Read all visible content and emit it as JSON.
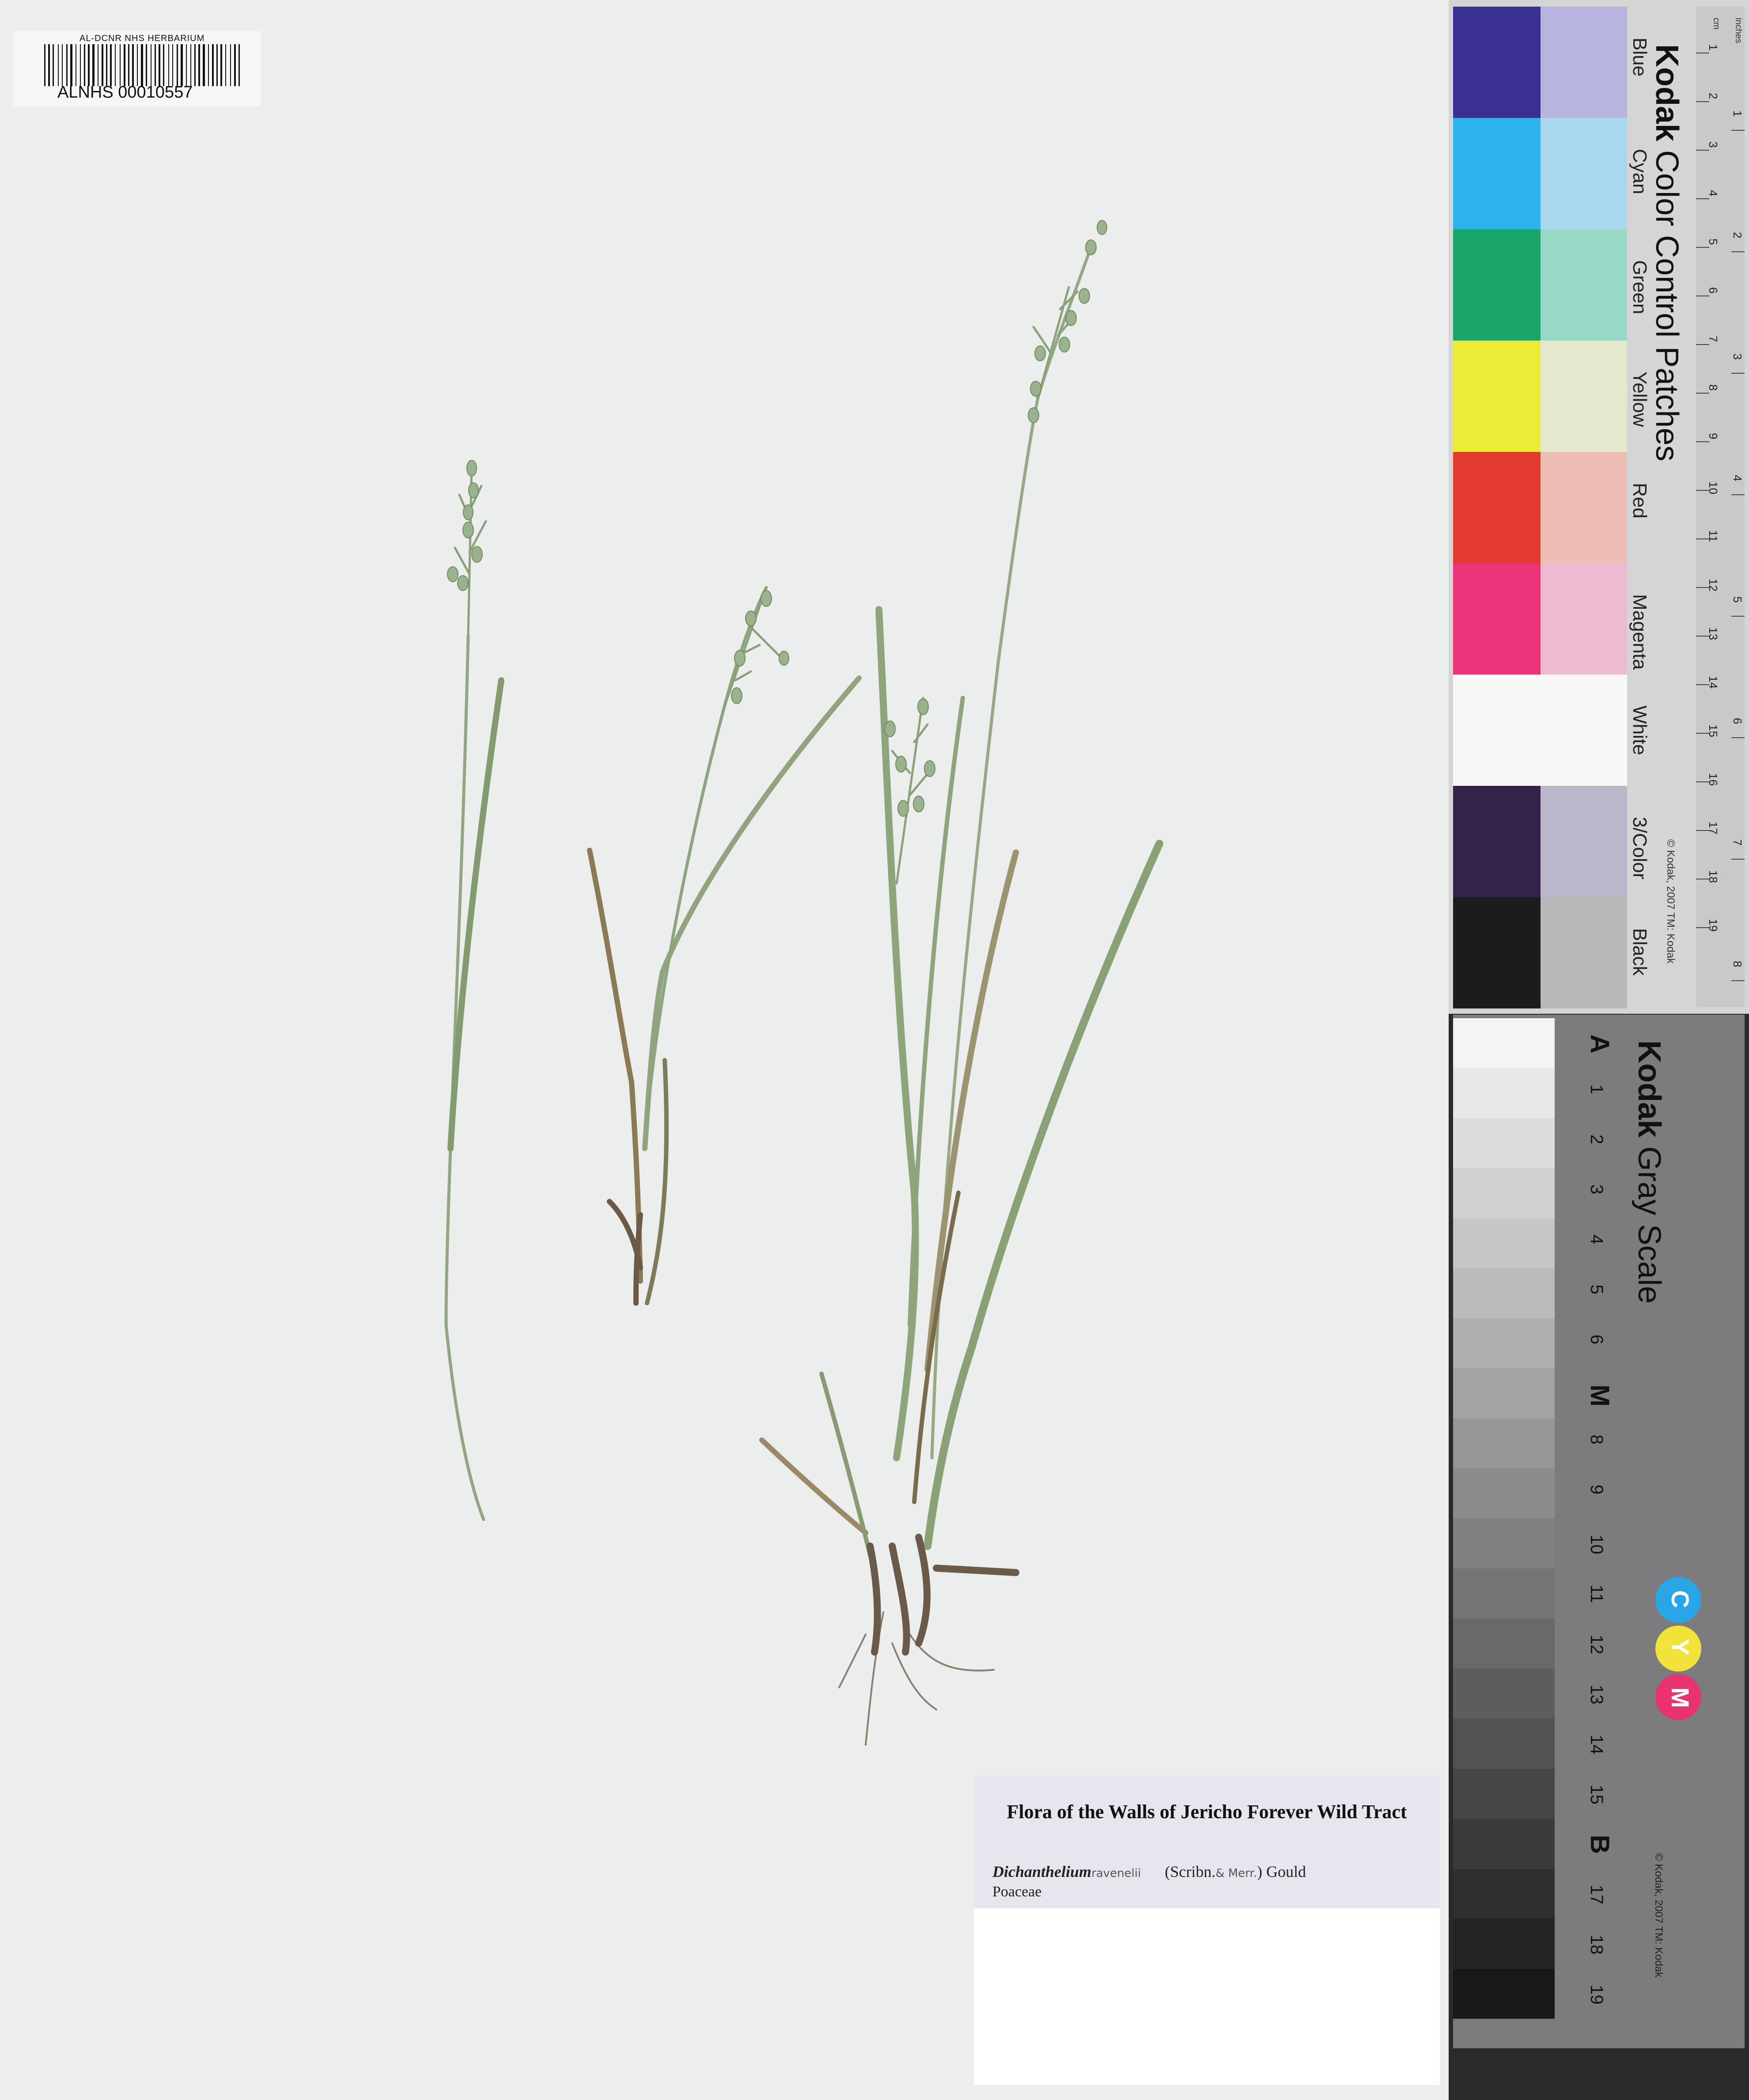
{
  "specimen": {
    "barcode_header": "AL-DCNR NHS HERBARIUM",
    "barcode_number": "ALNHS 00010557"
  },
  "label": {
    "title": "Flora of the Walls of Jericho Forever Wild Tract",
    "genus": "Dichanthelium",
    "epithet_handwritten": "ravenelii",
    "authors_1": "(Scribn.",
    "authors_hand": "& Merr.",
    "authors_2": ") Gould",
    "family": "Poaceae"
  },
  "color_card": {
    "brand": "Kodak",
    "title": "Color Control Patches",
    "unit_cm": "cm",
    "unit_inches": "inches",
    "patches": [
      {
        "name": "Blue",
        "dark": "#3a2f93",
        "light": "#b7b4e0"
      },
      {
        "name": "Cyan",
        "dark": "#2cb3ee",
        "light": "#a8d7ee"
      },
      {
        "name": "Green",
        "dark": "#1aa56b",
        "light": "#98d8c6"
      },
      {
        "name": "Yellow",
        "dark": "#ecec37",
        "light": "#e4e8cc"
      },
      {
        "name": "Red",
        "dark": "#e33a2f",
        "light": "#eebeb6"
      },
      {
        "name": "Magenta",
        "dark": "#ea3379",
        "light": "#edbad2"
      },
      {
        "name": "White",
        "dark": "#f8f8f8",
        "light": "#f8f8f8"
      },
      {
        "name": "3/Color",
        "dark": "#33234a",
        "light": "#b9b7c9"
      },
      {
        "name": "Black",
        "dark": "#1c1c1e",
        "light": "#b9b9b9"
      }
    ],
    "ruler_cm": [
      "1",
      "2",
      "3",
      "4",
      "5",
      "6",
      "7",
      "8",
      "9",
      "10",
      "11",
      "12",
      "13",
      "14",
      "15",
      "16",
      "17",
      "18",
      "19"
    ],
    "ruler_in": [
      "1",
      "2",
      "3",
      "4",
      "5",
      "6",
      "7",
      "8"
    ],
    "copyright": "© Kodak, 2007 TM: Kodak"
  },
  "gray_card": {
    "brand": "Kodak",
    "title": "Gray Scale",
    "steps": [
      "A",
      "1",
      "2",
      "3",
      "4",
      "5",
      "6",
      "M",
      "8",
      "9",
      "10",
      "11",
      "12",
      "13",
      "14",
      "15",
      "B",
      "17",
      "18",
      "19"
    ],
    "cmy": [
      {
        "letter": "C",
        "color": "#2aa6e8"
      },
      {
        "letter": "Y",
        "color": "#f1e33a"
      },
      {
        "letter": "M",
        "color": "#e8336f"
      }
    ],
    "copyright": "© Kodak, 2007 TM: Kodak"
  }
}
